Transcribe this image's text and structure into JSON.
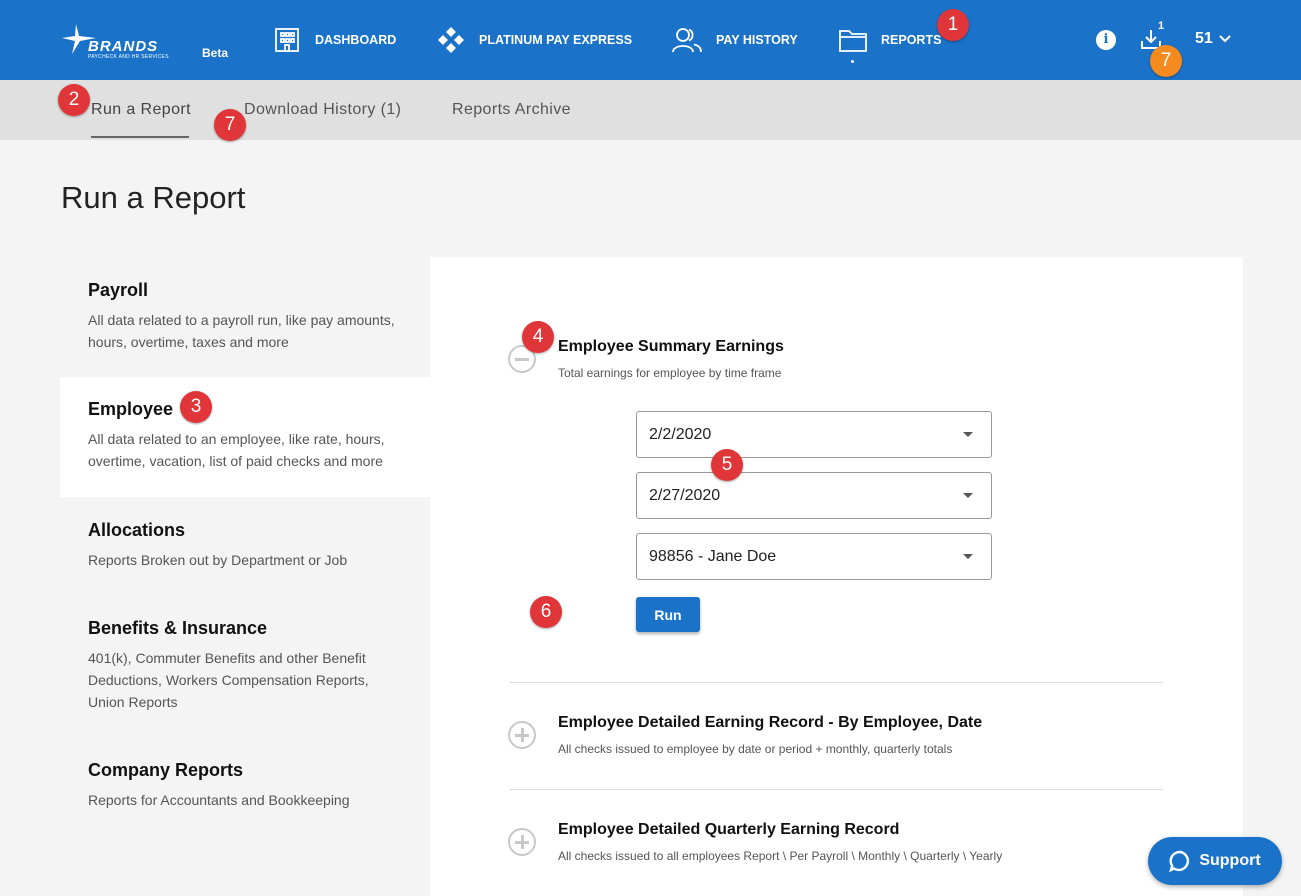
{
  "brand": {
    "name": "BRANDS",
    "tagline": "PAYCHECK AND HR SERVICES",
    "beta": "Beta"
  },
  "nav": {
    "dashboard": "DASHBOARD",
    "express": "PLATINUM PAY EXPRESS",
    "history": "PAY HISTORY",
    "reports": "REPORTS"
  },
  "header": {
    "info": "i",
    "download_count": "1",
    "user": "51"
  },
  "subtabs": {
    "run": "Run a Report",
    "download": "Download History (1)",
    "archive": "Reports Archive"
  },
  "page_title": "Run a Report",
  "categories": [
    {
      "title": "Payroll",
      "desc": "All data related to a payroll run, like pay amounts, hours, overtime, taxes and more"
    },
    {
      "title": "Employee",
      "desc": "All data related to an employee, like rate, hours, overtime, vacation, list of paid checks and more"
    },
    {
      "title": "Allocations",
      "desc": "Reports Broken out by Department or Job"
    },
    {
      "title": "Benefits & Insurance",
      "desc": "401(k), Commuter Benefits and other Benefit Deductions, Workers Compensation Reports, Union Reports"
    },
    {
      "title": "Company Reports",
      "desc": "Reports for Accountants and Bookkeeping"
    }
  ],
  "reports": [
    {
      "title": "Employee Summary Earnings",
      "desc": "Total earnings for employee by time frame"
    },
    {
      "title": "Employee Detailed Earning Record - By Employee, Date",
      "desc": "All checks issued to employee by date or period + monthly, quarterly totals"
    },
    {
      "title": "Employee Detailed Quarterly Earning Record",
      "desc": "All checks issued to all employees Report \\ Per Payroll \\ Monthly \\ Quarterly \\ Yearly"
    }
  ],
  "form": {
    "start_date": "2/2/2020",
    "end_date": "2/27/2020",
    "employee": "98856 - Jane Doe",
    "run": "Run"
  },
  "badges": {
    "b1": "1",
    "b2": "2",
    "b3": "3",
    "b4": "4",
    "b5": "5",
    "b6": "6",
    "b7": "7"
  },
  "support": "Support",
  "colors": {
    "primary": "#1a73c9",
    "badge_red": "#e0363a",
    "badge_orange": "#f58a1f"
  }
}
